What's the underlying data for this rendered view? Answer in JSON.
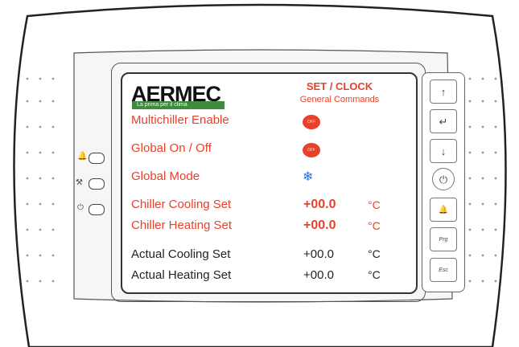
{
  "brand": {
    "logo": "AERMEC",
    "tagline": "La prima  per il clima"
  },
  "header": {
    "title": "SET / CLOCK",
    "subtitle": "General Commands"
  },
  "rows": [
    {
      "label": "Multichiller Enable",
      "kind": "toggle",
      "value": "OFF"
    },
    {
      "label": "Global On / Off",
      "kind": "toggle",
      "value": "OFF"
    },
    {
      "label": "Global Mode",
      "kind": "mode",
      "icon": "snowflake-icon",
      "value": "❄"
    },
    {
      "label": "Chiller Cooling Set",
      "kind": "setpoint",
      "value": "+00.0",
      "unit": "°C"
    },
    {
      "label": "Chiller Heating Set",
      "kind": "setpoint",
      "value": "+00.0",
      "unit": "°C"
    },
    {
      "label": "Actual Cooling Set",
      "kind": "readout",
      "value": "+00.0",
      "unit": "°C"
    },
    {
      "label": "Actual Heating Set",
      "kind": "readout",
      "value": "+00.0",
      "unit": "°C"
    }
  ],
  "keys": {
    "up": "↑",
    "enter": "↵",
    "down": "↓",
    "power": "⏻",
    "alarm": "🔔",
    "prg": "Prg",
    "esc": "Esc"
  },
  "leds": {
    "alarm": "alarm-led-icon",
    "wrench": "wrench-led-icon",
    "power": "power-led-icon"
  },
  "colors": {
    "accent": "#e8402a",
    "text": "#222222",
    "brand_green": "#3d8b3d",
    "mode_icon": "#2a6cd6"
  }
}
